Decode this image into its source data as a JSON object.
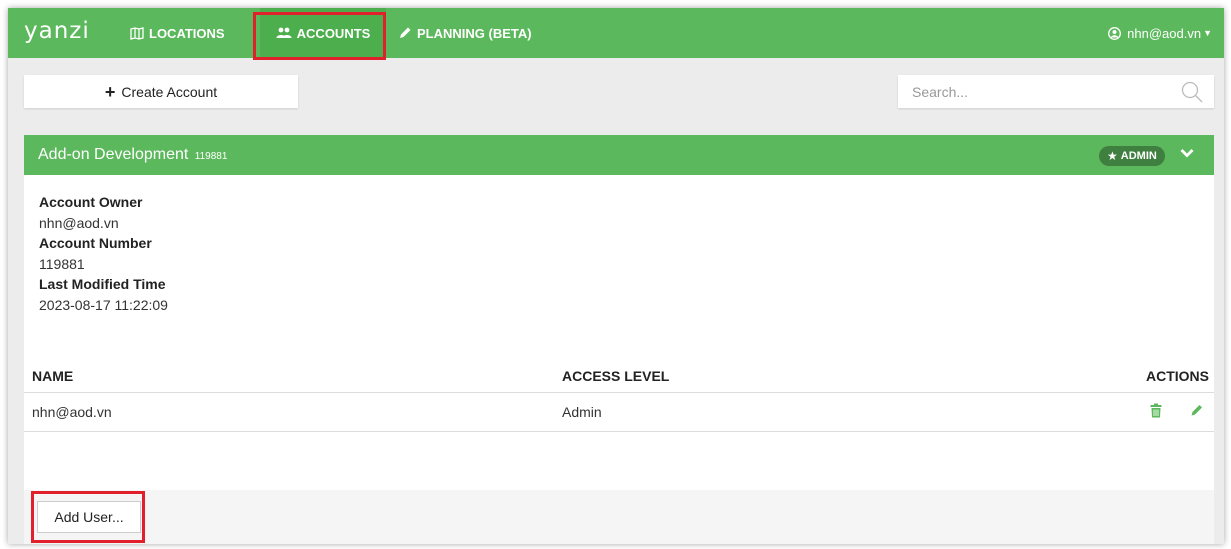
{
  "navbar": {
    "brand": "yanzi",
    "items": [
      {
        "label": "LOCATIONS",
        "icon": "map-icon"
      },
      {
        "label": "ACCOUNTS",
        "icon": "users-icon",
        "active": true
      },
      {
        "label": "PLANNING (BETA)",
        "icon": "pencil-icon"
      }
    ],
    "user": "nhn@aod.vn"
  },
  "toolbar": {
    "create_label": "Create Account",
    "search_placeholder": "Search..."
  },
  "account": {
    "name": "Add-on Development",
    "number_small": "119881",
    "badge": "ADMIN",
    "owner_label": "Account Owner",
    "owner": "nhn@aod.vn",
    "number_label": "Account Number",
    "number": "119881",
    "modified_label": "Last Modified Time",
    "modified": "2023-08-17 11:22:09"
  },
  "table": {
    "headers": [
      "NAME",
      "ACCESS LEVEL",
      "ACTIONS"
    ],
    "rows": [
      {
        "name": "nhn@aod.vn",
        "access": "Admin"
      }
    ]
  },
  "footer": {
    "add_user_label": "Add User..."
  },
  "colors": {
    "brand_green": "#5cb85c",
    "highlight_red": "#e0202a"
  }
}
